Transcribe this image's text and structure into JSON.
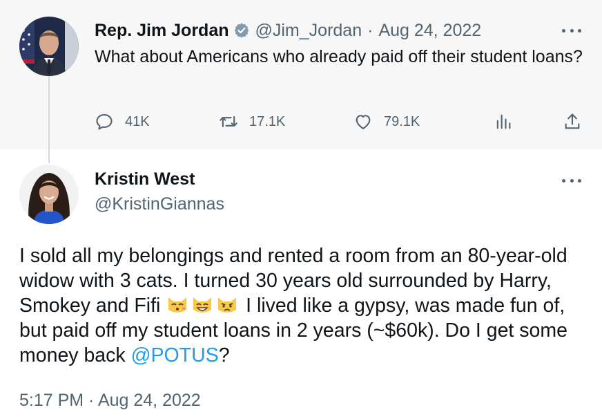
{
  "quoted_tweet": {
    "author_name": "Rep. Jim Jordan",
    "handle": "@Jim_Jordan",
    "separator": "·",
    "date": "Aug 24, 2022",
    "text": "What about Americans who already paid off their student loans?",
    "verified": true,
    "metrics": {
      "replies": "41K",
      "retweets": "17.1K",
      "likes": "79.1K"
    }
  },
  "reply_tweet": {
    "author_name": "Kristin West",
    "handle": "@KristinGiannas",
    "text_part1": "I sold all my belongings and rented a room from an 80-year-old widow with 3 cats. I turned 30 years old surrounded by Harry, Smokey and Fifi ",
    "emojis": [
      "kissing-cat-emoji",
      "grinning-cat-emoji",
      "pouting-cat-emoji"
    ],
    "text_part2": " I lived like a gypsy, was made fun of, but paid off my student loans in 2 years (~$60k). Do I get some money back ",
    "mention": "@POTUS",
    "text_part3": "?",
    "timestamp": "5:17 PM · Aug 24, 2022"
  },
  "colors": {
    "quoted_bg": "#f7f7f7",
    "text": "#0f1419",
    "muted": "#536471",
    "link": "#1d9bf0",
    "verified": "#829aab"
  }
}
